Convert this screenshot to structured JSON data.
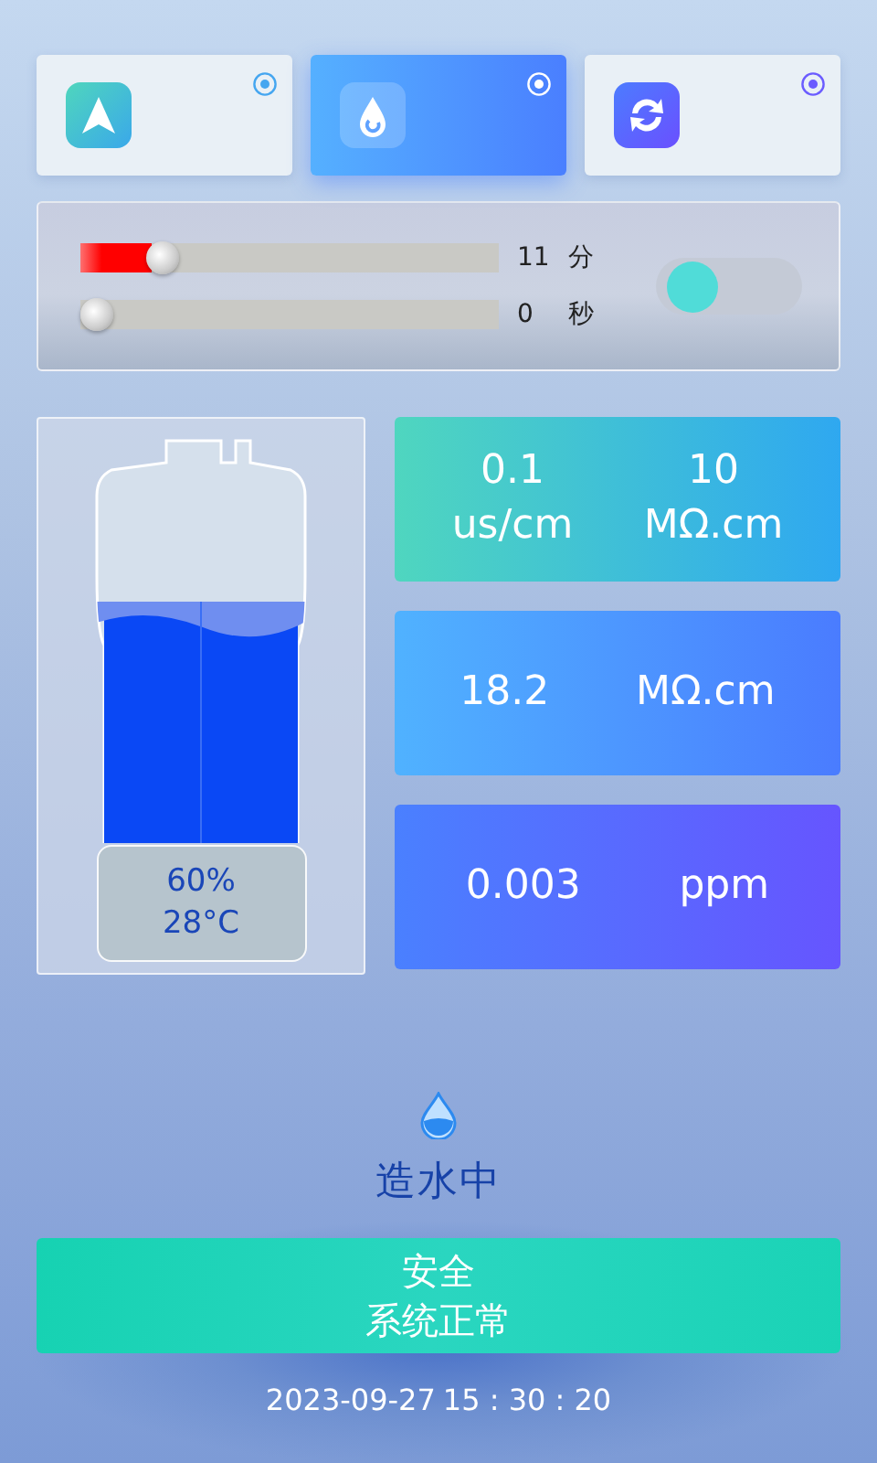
{
  "modes": [
    {
      "kind": "navigate",
      "selected": false
    },
    {
      "kind": "drop",
      "selected": true
    },
    {
      "kind": "refresh",
      "selected": false
    }
  ],
  "timer": {
    "sliders": [
      {
        "level": 0.17,
        "value": "11",
        "unit": "分"
      },
      {
        "level": 0,
        "value": "0",
        "unit": "秒"
      }
    ],
    "toggle": {
      "on": false
    }
  },
  "tank": {
    "level": 0.6,
    "percent": "60%",
    "temperature": "28°C"
  },
  "readings": [
    {
      "columns": [
        {
          "value": "0.1",
          "unit": "us/cm"
        },
        {
          "value": "10",
          "unit": "MΩ.cm"
        }
      ]
    },
    {
      "columns": [
        {
          "value": "18.2",
          "unit": "MΩ.cm"
        }
      ]
    },
    {
      "columns": [
        {
          "value": "0.003",
          "unit": "ppm"
        }
      ]
    }
  ],
  "status_label": "造水中",
  "banner": {
    "title": "安全",
    "message": "系统正常"
  },
  "date": "2023-09-27",
  "time": "15 : 30 : 20"
}
